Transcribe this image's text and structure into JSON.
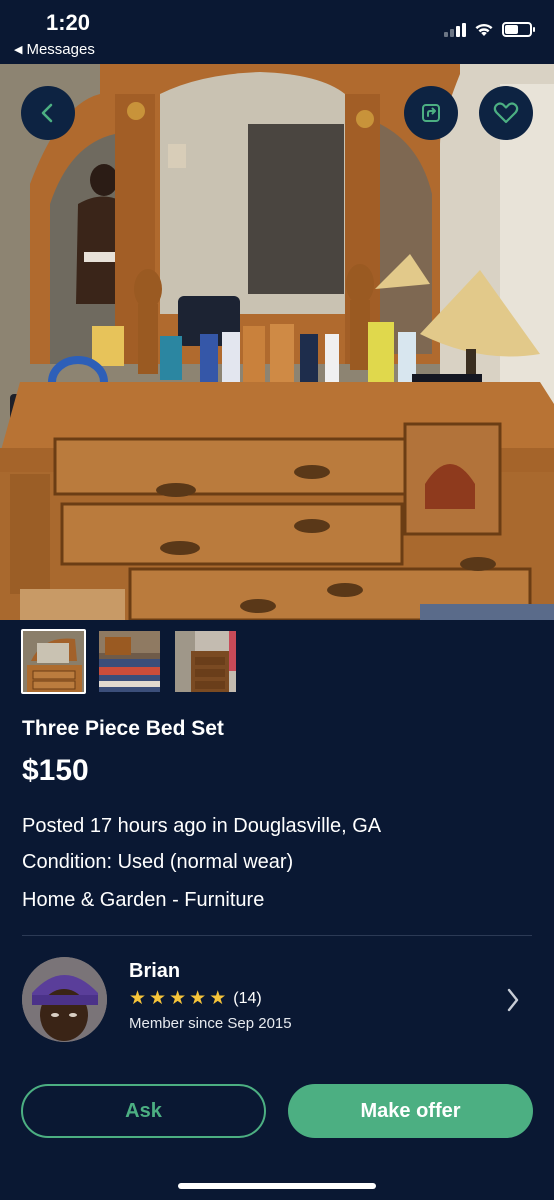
{
  "status_bar": {
    "time": "1:20",
    "back_app": "Messages",
    "signal_bars": 4,
    "signal_active": 2,
    "icons": [
      "signal-icon",
      "wifi-icon",
      "battery-icon"
    ]
  },
  "hero": {
    "buttons": [
      "back-icon",
      "share-icon",
      "heart-icon"
    ]
  },
  "thumbnails": {
    "count": 3,
    "selected_index": 0
  },
  "listing": {
    "title": "Three Piece Bed Set",
    "price": "$150",
    "posted": "Posted 17 hours ago in Douglasville, GA",
    "condition": "Condition: Used (normal wear)",
    "category": "Home & Garden - Furniture"
  },
  "seller": {
    "name": "Brian",
    "stars": 5,
    "rating_count": "(14)",
    "member_since": "Member since Sep 2015"
  },
  "actions": {
    "ask_label": "Ask",
    "offer_label": "Make offer"
  },
  "colors": {
    "background": "#0a1833",
    "accent": "#4caf82",
    "star": "#f6c43a"
  }
}
